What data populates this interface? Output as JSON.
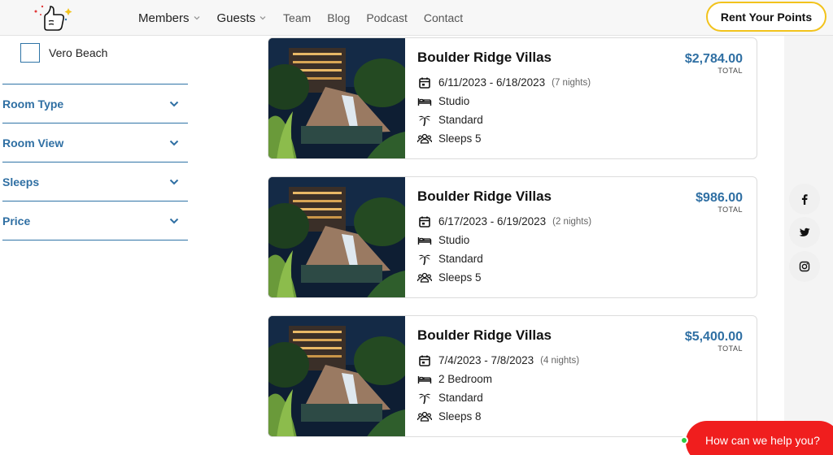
{
  "header": {
    "nav": [
      {
        "label": "Members",
        "dropdown": true
      },
      {
        "label": "Guests",
        "dropdown": true
      },
      {
        "label": "Team",
        "dropdown": false
      },
      {
        "label": "Blog",
        "dropdown": false
      },
      {
        "label": "Podcast",
        "dropdown": false
      },
      {
        "label": "Contact",
        "dropdown": false
      }
    ],
    "cta_label": "Rent Your Points",
    "logo_icon": "thumbs-up-sparkle-logo"
  },
  "sidebar": {
    "location_option": {
      "label": "Vero Beach",
      "checked": false
    },
    "filters": [
      {
        "label": "Room Type"
      },
      {
        "label": "Room View"
      },
      {
        "label": "Sleeps"
      },
      {
        "label": "Price"
      }
    ]
  },
  "listings": [
    {
      "title": "Boulder Ridge Villas",
      "dates": "6/11/2023 - 6/18/2023",
      "nights": "(7 nights)",
      "room": "Studio",
      "view": "Standard",
      "sleeps": "Sleeps 5",
      "price": "$2,784.00",
      "price_label": "TOTAL"
    },
    {
      "title": "Boulder Ridge Villas",
      "dates": "6/17/2023 - 6/19/2023",
      "nights": "(2 nights)",
      "room": "Studio",
      "view": "Standard",
      "sleeps": "Sleeps 5",
      "price": "$986.00",
      "price_label": "TOTAL"
    },
    {
      "title": "Boulder Ridge Villas",
      "dates": "7/4/2023 - 7/8/2023",
      "nights": "(4 nights)",
      "room": "2 Bedroom",
      "view": "Standard",
      "sleeps": "Sleeps 8",
      "price": "$5,400.00",
      "price_label": "TOTAL"
    }
  ],
  "social": [
    "facebook-icon",
    "twitter-icon",
    "instagram-icon"
  ],
  "chat": {
    "label": "How can we help you?",
    "status_color": "#2ecc40"
  },
  "colors": {
    "accent_blue": "#2f6fa3",
    "cta_border": "#f2c31c",
    "chat_red": "#f01e1e"
  }
}
